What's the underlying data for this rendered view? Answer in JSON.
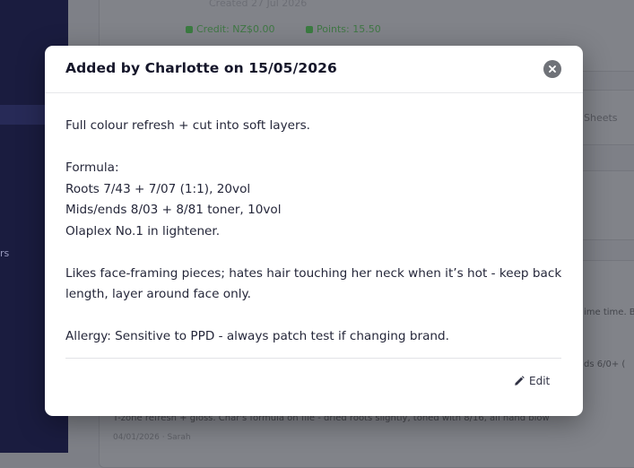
{
  "background": {
    "sidebar_label": "rs",
    "created_text": "Created 27 Jul 2026",
    "credit_pill": "Credit: NZ$0.00",
    "points_pill": "Points: 15.50",
    "tab_fragment": "Sheets",
    "note_snippet_1": "ime time. Bi",
    "note_snippet_2": "ds 6/0+ (",
    "note_snippet_3": "T-zone refresh + gloss. Char's formula on file - dried roots slightly, toned with 8/16, all hand blow",
    "note_meta": "04/01/2026 · Sarah"
  },
  "modal": {
    "title": "Added by Charlotte on 15/05/2026",
    "close_icon": "close-icon",
    "body_lines": [
      "Full colour refresh + cut into soft layers.",
      "",
      "Formula:",
      "Roots 7/43 + 7/07 (1:1), 20vol",
      "Mids/ends 8/03 + 8/81 toner, 10vol",
      "Olaplex No.1 in lightener.",
      "",
      "Likes face-framing pieces; hates hair touching her neck when it’s hot - keep back length, layer around face only.",
      "",
      "Allergy: Sensitive to PPD - always patch test if changing brand."
    ],
    "edit_label": "Edit",
    "edit_icon": "pencil-icon"
  },
  "colors": {
    "overlay": "#7e8087",
    "sidebar": "#1a1c3f",
    "modal_bg": "#ffffff",
    "title_text": "#15162a",
    "close_button_bg": "#6f7278",
    "pill_green": "#3b7b41"
  }
}
